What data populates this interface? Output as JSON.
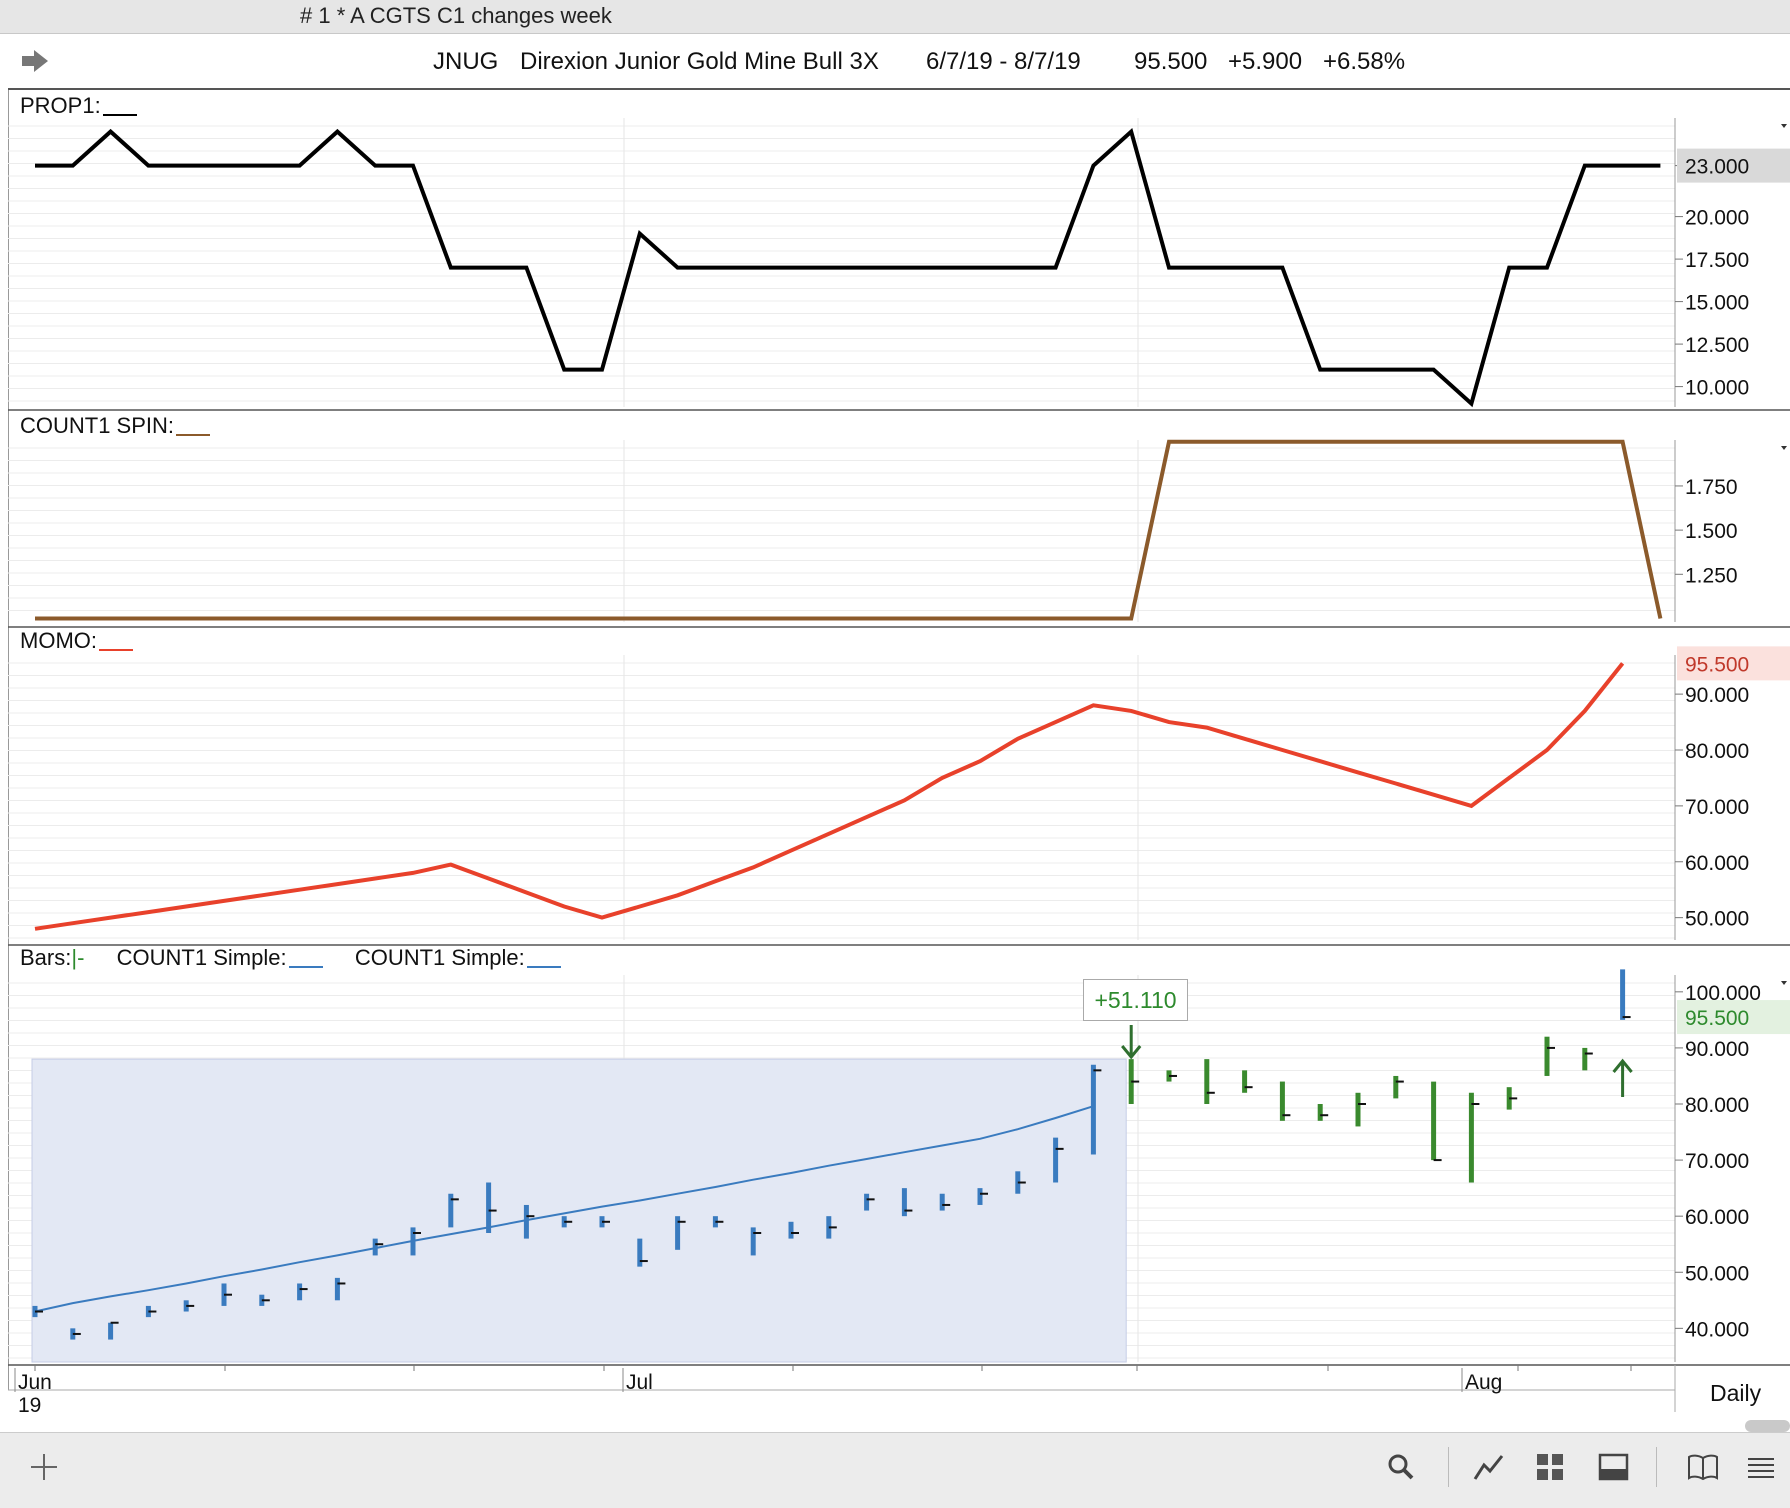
{
  "window": {
    "title": "# 1 * A CGTS  C1 changes week"
  },
  "header": {
    "symbol": "JNUG",
    "name": "Direxion Junior Gold Mine Bull 3X",
    "date_range": "6/7/19 - 8/7/19",
    "last": "95.500",
    "change": "+5.900",
    "change_pct": "+6.58%"
  },
  "panels": {
    "prop1": {
      "label": "PROP1:",
      "color": "#000000",
      "badge": "23.000"
    },
    "spin": {
      "label": "COUNT1 SPIN:",
      "color": "#8b5a2b"
    },
    "momo": {
      "label": "MOMO:",
      "color": "#e8412b",
      "badge": "95.500"
    },
    "bars": {
      "label_bars": "Bars:",
      "label_bars_mark": "|-",
      "label_c1": "COUNT1 Simple:",
      "label_c2": "COUNT1 Simple:",
      "badge": "95.500",
      "callout": "+51.110"
    }
  },
  "x_axis": {
    "labels": [
      "Jun",
      "Jul",
      "Aug"
    ],
    "year": "19",
    "period": "Daily"
  },
  "chart_data": [
    {
      "type": "line",
      "name": "PROP1",
      "y": [
        23,
        23,
        25,
        23,
        23,
        23,
        23,
        23,
        25,
        23,
        23,
        17,
        17,
        17,
        11,
        11,
        19,
        17,
        17,
        17,
        17,
        17,
        17,
        17,
        17,
        17,
        17,
        17,
        23,
        25,
        17,
        17,
        17,
        17,
        11,
        11,
        11,
        11,
        9,
        17,
        17,
        23,
        23,
        23
      ],
      "ylim": [
        8.8,
        25.8
      ],
      "yticks": [
        "23.000",
        "20.000",
        "17.500",
        "15.000",
        "12.500",
        "10.000"
      ]
    },
    {
      "type": "line",
      "name": "COUNT1 SPIN",
      "y": [
        1,
        1,
        1,
        1,
        1,
        1,
        1,
        1,
        1,
        1,
        1,
        1,
        1,
        1,
        1,
        1,
        1,
        1,
        1,
        1,
        1,
        1,
        1,
        1,
        1,
        1,
        1,
        1,
        1,
        1,
        2,
        2,
        2,
        2,
        2,
        2,
        2,
        2,
        2,
        2,
        2,
        2,
        2,
        1
      ],
      "ylim": [
        0.98,
        2.01
      ],
      "yticks": [
        "1.750",
        "1.500",
        "1.250"
      ]
    },
    {
      "type": "line",
      "name": "MOMO",
      "y": [
        48,
        49,
        50,
        51,
        52,
        53,
        54,
        55,
        56,
        57,
        58,
        59.5,
        57,
        54.5,
        52,
        50,
        52,
        54,
        56.5,
        59,
        62,
        65,
        68,
        71,
        75,
        78,
        82,
        85,
        88,
        87,
        85,
        84,
        82,
        80,
        78,
        76,
        74,
        72,
        70,
        75,
        80,
        87,
        95.5
      ],
      "ylim": [
        46,
        97
      ],
      "yticks": [
        "90.000",
        "80.000",
        "70.000",
        "60.000",
        "50.000"
      ]
    },
    {
      "type": "ohlc",
      "name": "Bars",
      "ylim": [
        34,
        103
      ],
      "yticks": [
        "100.000",
        "90.000",
        "80.000",
        "70.000",
        "60.000",
        "50.000",
        "40.000"
      ],
      "bars": [
        {
          "h": 44,
          "l": 42,
          "c": 43,
          "up": 0
        },
        {
          "h": 40,
          "l": 38,
          "c": 39,
          "up": 0
        },
        {
          "h": 41,
          "l": 38,
          "c": 41,
          "up": 0
        },
        {
          "h": 44,
          "l": 42,
          "c": 43,
          "up": 0
        },
        {
          "h": 45,
          "l": 43,
          "c": 44,
          "up": 0
        },
        {
          "h": 48,
          "l": 44,
          "c": 46,
          "up": 0
        },
        {
          "h": 46,
          "l": 44,
          "c": 45,
          "up": 0
        },
        {
          "h": 48,
          "l": 45,
          "c": 47,
          "up": 0
        },
        {
          "h": 49,
          "l": 45,
          "c": 48,
          "up": 0
        },
        {
          "h": 56,
          "l": 53,
          "c": 55,
          "up": 0
        },
        {
          "h": 58,
          "l": 53,
          "c": 57,
          "up": 0
        },
        {
          "h": 64,
          "l": 58,
          "c": 63,
          "up": 0
        },
        {
          "h": 66,
          "l": 57,
          "c": 61,
          "up": 0
        },
        {
          "h": 62,
          "l": 56,
          "c": 60,
          "up": 0
        },
        {
          "h": 60,
          "l": 58,
          "c": 59,
          "up": 0
        },
        {
          "h": 60,
          "l": 58,
          "c": 59,
          "up": 0
        },
        {
          "h": 56,
          "l": 51,
          "c": 52,
          "up": 0
        },
        {
          "h": 60,
          "l": 54,
          "c": 59,
          "up": 0
        },
        {
          "h": 60,
          "l": 58,
          "c": 59,
          "up": 0
        },
        {
          "h": 58,
          "l": 53,
          "c": 57,
          "up": 0
        },
        {
          "h": 59,
          "l": 56,
          "c": 57,
          "up": 0
        },
        {
          "h": 60,
          "l": 56,
          "c": 58,
          "up": 0
        },
        {
          "h": 64,
          "l": 61,
          "c": 63,
          "up": 0
        },
        {
          "h": 65,
          "l": 60,
          "c": 61,
          "up": 0
        },
        {
          "h": 64,
          "l": 61,
          "c": 62,
          "up": 0
        },
        {
          "h": 65,
          "l": 62,
          "c": 64,
          "up": 0
        },
        {
          "h": 68,
          "l": 64,
          "c": 66,
          "up": 0
        },
        {
          "h": 74,
          "l": 66,
          "c": 72,
          "up": 0
        },
        {
          "h": 87,
          "l": 71,
          "c": 86,
          "up": 0
        },
        {
          "h": 88,
          "l": 80,
          "c": 84,
          "up": 1
        },
        {
          "h": 86,
          "l": 84,
          "c": 85,
          "up": 1
        },
        {
          "h": 88,
          "l": 80,
          "c": 82,
          "up": 1
        },
        {
          "h": 86,
          "l": 82,
          "c": 83,
          "up": 1
        },
        {
          "h": 84,
          "l": 77,
          "c": 78,
          "up": 1
        },
        {
          "h": 80,
          "l": 77,
          "c": 78,
          "up": 1
        },
        {
          "h": 82,
          "l": 76,
          "c": 80,
          "up": 1
        },
        {
          "h": 85,
          "l": 81,
          "c": 84,
          "up": 1
        },
        {
          "h": 84,
          "l": 70,
          "c": 70,
          "up": 1
        },
        {
          "h": 82,
          "l": 66,
          "c": 80,
          "up": 1
        },
        {
          "h": 83,
          "l": 79,
          "c": 81,
          "up": 1
        },
        {
          "h": 92,
          "l": 85,
          "c": 90,
          "up": 1
        },
        {
          "h": 90,
          "l": 86,
          "c": 89,
          "up": 1
        },
        {
          "h": 104,
          "l": 95,
          "c": 95.5,
          "up": 0
        }
      ],
      "sma": [
        43,
        44.5,
        45.7,
        46.8,
        48,
        49.3,
        50.5,
        51.8,
        53,
        54.3,
        55.6,
        56.8,
        58,
        59.3,
        60.5,
        61.7,
        62.8,
        64,
        65.2,
        66.5,
        67.7,
        69,
        70.2,
        71.4,
        72.6,
        73.8,
        75.5,
        77.5,
        79.6
      ]
    }
  ]
}
